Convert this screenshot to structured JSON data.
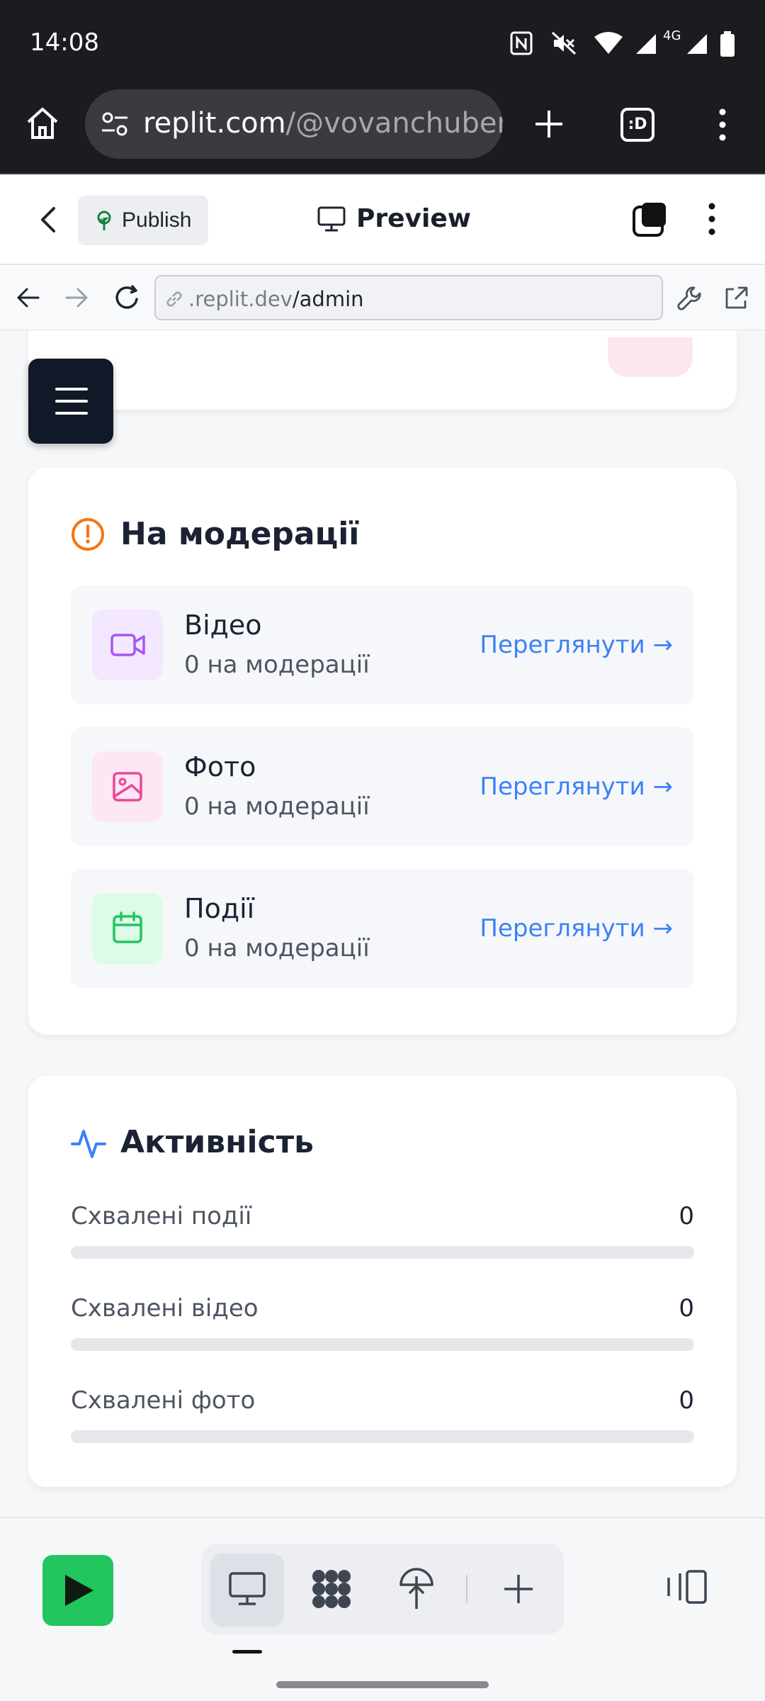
{
  "status_bar": {
    "time": "14:08",
    "icons": [
      "nfc-icon",
      "mute-icon",
      "wifi-icon",
      "signal-icon",
      "4g-signal-icon",
      "battery-icon"
    ],
    "network_label": "4G"
  },
  "browser": {
    "url_domain": "replit.com",
    "url_path": "/@vovanchubenk",
    "tab_count_label": ":D"
  },
  "replit_header": {
    "publish_label": "Publish",
    "preview_label": "Preview"
  },
  "inner_browser": {
    "url_dim": ".replit.dev",
    "url_path": "/admin"
  },
  "moderation": {
    "title": "На модерації",
    "items": [
      {
        "title": "Відео",
        "subtitle": "0 на модерації",
        "link": "Переглянути →",
        "icon": "video-icon",
        "icon_color": "#a855f7",
        "bg_color": "#f3e8ff"
      },
      {
        "title": "Фото",
        "subtitle": "0 на модерації",
        "link": "Переглянути →",
        "icon": "image-icon",
        "icon_color": "#ec4899",
        "bg_color": "#fce7f3"
      },
      {
        "title": "Події",
        "subtitle": "0 на модерації",
        "link": "Переглянути →",
        "icon": "calendar-icon",
        "icon_color": "#22c55e",
        "bg_color": "#dcfce7"
      }
    ]
  },
  "activity": {
    "title": "Активність",
    "items": [
      {
        "label": "Схвалені події",
        "value": "0",
        "progress": 0
      },
      {
        "label": "Схвалені відео",
        "value": "0",
        "progress": 0
      },
      {
        "label": "Схвалені фото",
        "value": "0",
        "progress": 0
      }
    ]
  },
  "colors": {
    "accent_blue": "#3b82f6",
    "warning_orange": "#f97316",
    "run_green": "#22c55e",
    "menu_button": "#111827"
  }
}
